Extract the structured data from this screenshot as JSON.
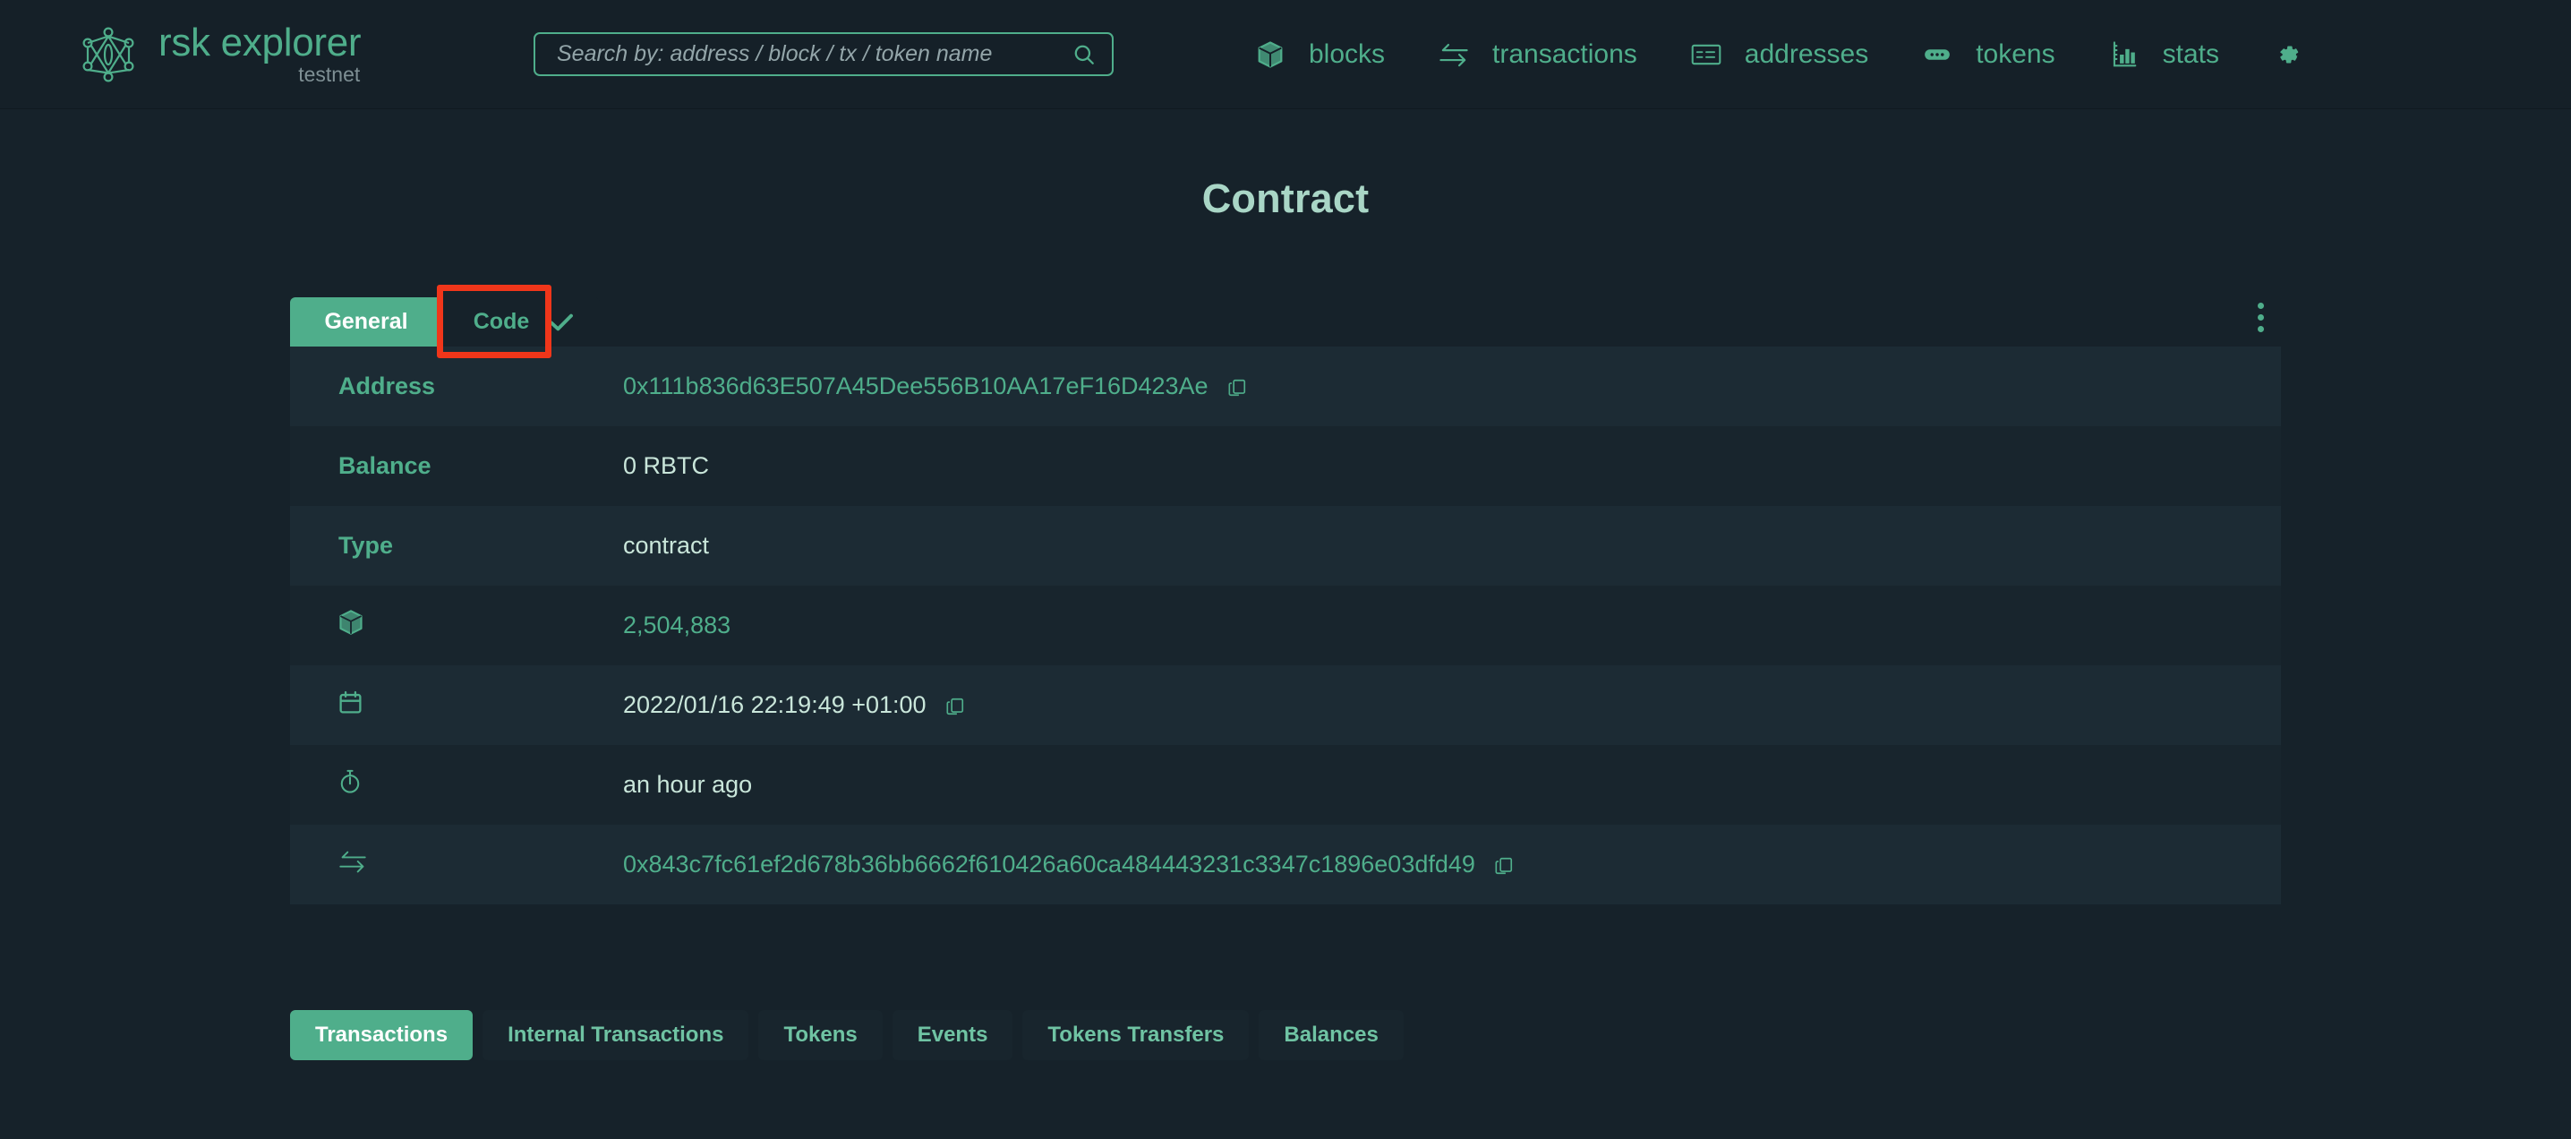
{
  "colors": {
    "accent": "#4fae8b",
    "page_bg": "#16222a",
    "header_bg": "#152028",
    "row_odd": "#1c2b34",
    "row_even": "#18252d",
    "highlight": "#f0361a",
    "value_text": "#c9e6da"
  },
  "header": {
    "brand": {
      "title": "rsk explorer",
      "subtitle": "testnet",
      "logo_icon": "rsk-logo-icon"
    },
    "search": {
      "placeholder": "Search by: address / block / tx / token name",
      "value": "",
      "icon": "search-icon"
    },
    "nav": [
      {
        "label": "blocks",
        "icon": "cube-icon"
      },
      {
        "label": "transactions",
        "icon": "swap-arrows-icon"
      },
      {
        "label": "addresses",
        "icon": "card-icon"
      },
      {
        "label": "tokens",
        "icon": "token-icon"
      },
      {
        "label": "stats",
        "icon": "bar-chart-icon"
      }
    ],
    "settings_icon": "gear-icon"
  },
  "page": {
    "title": "Contract"
  },
  "tabs": {
    "items": [
      {
        "label": "General",
        "active": true,
        "checked": false,
        "highlighted": false
      },
      {
        "label": "Code",
        "active": false,
        "checked": true,
        "highlighted": true
      }
    ],
    "overflow_menu_icon": "kebab-menu-icon"
  },
  "details": {
    "rows": [
      {
        "label": "Address",
        "icon": null,
        "value": "0x111b836d63E507A45Dee556B10AA17eF16D423Ae",
        "is_link": true,
        "copy": true
      },
      {
        "label": "Balance",
        "icon": null,
        "value": "0 RBTC",
        "is_link": false,
        "copy": false
      },
      {
        "label": "Type",
        "icon": null,
        "value": "contract",
        "is_link": false,
        "copy": false
      },
      {
        "label": "",
        "icon": "cube-icon",
        "value": "2,504,883",
        "is_link": true,
        "copy": false
      },
      {
        "label": "",
        "icon": "calendar-icon",
        "value": "2022/01/16 22:19:49 +01:00",
        "is_link": false,
        "copy": true
      },
      {
        "label": "",
        "icon": "stopwatch-icon",
        "value": "an hour ago",
        "is_link": false,
        "copy": false
      },
      {
        "label": "",
        "icon": "swap-arrows-icon",
        "value": "0x843c7fc61ef2d678b36bb6662f610426a60ca484443231c3347c1896e03dfd49",
        "is_link": true,
        "copy": true
      }
    ]
  },
  "bottom_tabs": {
    "items": [
      {
        "label": "Transactions",
        "active": true
      },
      {
        "label": "Internal Transactions",
        "active": false
      },
      {
        "label": "Tokens",
        "active": false
      },
      {
        "label": "Events",
        "active": false
      },
      {
        "label": "Tokens Transfers",
        "active": false
      },
      {
        "label": "Balances",
        "active": false
      }
    ]
  }
}
